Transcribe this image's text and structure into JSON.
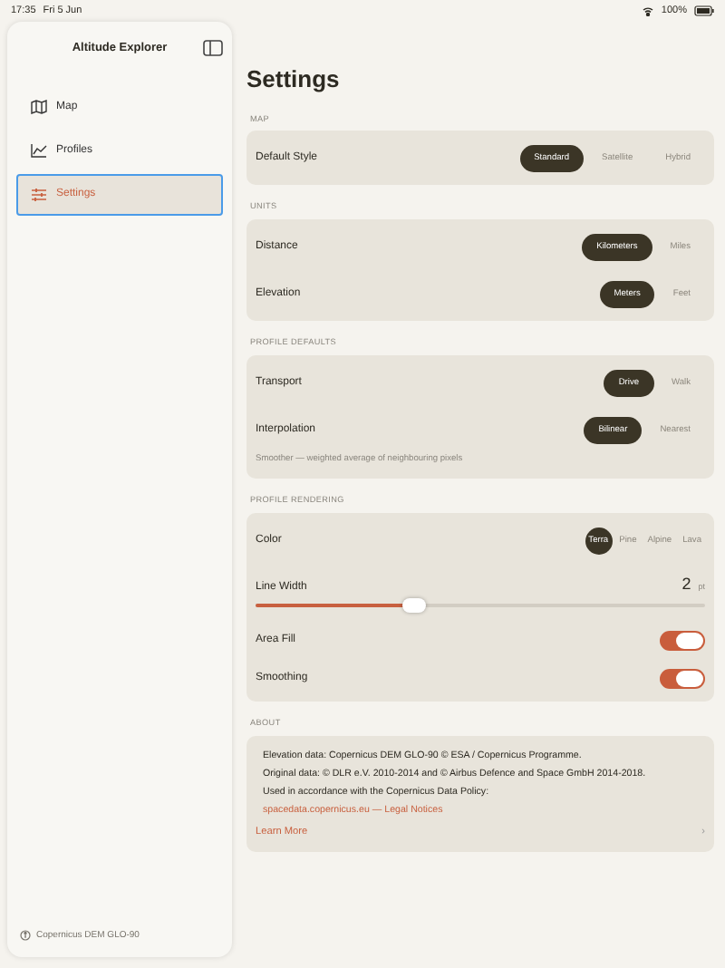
{
  "status_bar": {
    "time": "17:35",
    "date": "Fri 5 Jun",
    "battery": "100%"
  },
  "sidebar": {
    "title": "Altitude Explorer",
    "items": [
      {
        "label": "Map",
        "kind": "map",
        "selected": false
      },
      {
        "label": "Profiles",
        "kind": "chart",
        "selected": false
      },
      {
        "label": "Settings",
        "kind": "sliders",
        "selected": true
      }
    ],
    "footer": "Copernicus DEM GLO-90"
  },
  "title": "Settings",
  "sections": [
    {
      "header": "MAP",
      "rows": [
        {
          "kind": "segmented",
          "label": "Default Style",
          "options": [
            {
              "label": "Standard",
              "selected": true
            },
            {
              "label": "Satellite",
              "selected": false
            },
            {
              "label": "Hybrid",
              "selected": false
            }
          ]
        }
      ]
    },
    {
      "header": "UNITS",
      "rows": [
        {
          "kind": "segmented",
          "label": "Distance",
          "options": [
            {
              "label": "Kilometers",
              "selected": true
            },
            {
              "label": "Miles",
              "selected": false
            }
          ]
        },
        {
          "kind": "segmented",
          "label": "Elevation",
          "options": [
            {
              "label": "Meters",
              "selected": true
            },
            {
              "label": "Feet",
              "selected": false
            }
          ]
        }
      ]
    },
    {
      "header": "PROFILE DEFAULTS",
      "rows": [
        {
          "kind": "segmented",
          "label": "Transport",
          "options": [
            {
              "label": "Drive",
              "selected": true
            },
            {
              "label": "Walk",
              "selected": false
            }
          ]
        },
        {
          "kind": "segmented",
          "label": "Interpolation",
          "options": [
            {
              "label": "Bilinear",
              "selected": true
            },
            {
              "label": "Nearest",
              "selected": false
            }
          ]
        },
        {
          "kind": "note",
          "text": "Smoother — weighted average of neighbouring pixels"
        }
      ]
    },
    {
      "header": "PROFILE RENDERING",
      "rows": [
        {
          "kind": "swatches",
          "label": "Color",
          "options": [
            {
              "label": "Terra",
              "selected": true
            },
            {
              "label": "Pine",
              "selected": false
            },
            {
              "label": "Alpine",
              "selected": false
            },
            {
              "label": "Lava",
              "selected": false
            }
          ]
        },
        {
          "kind": "slider",
          "label": "Line Width",
          "value": "2",
          "unit": "pt",
          "level": 0.35
        },
        {
          "kind": "toggle",
          "label": "Area Fill",
          "on": true
        },
        {
          "kind": "toggle",
          "label": "Smoothing",
          "on": true
        }
      ]
    },
    {
      "header": "ABOUT",
      "rows": [
        {
          "kind": "text",
          "text": "Elevation data: Copernicus DEM GLO-90 © ESA / Copernicus Programme."
        },
        {
          "kind": "text",
          "text": "Original data: © DLR e.V. 2010-2014 and © Airbus Defence and Space GmbH 2014-2018."
        },
        {
          "kind": "text",
          "text": "Used in accordance with the Copernicus Data Policy:"
        },
        {
          "kind": "link",
          "text": "spacedata.copernicus.eu — Legal Notices"
        },
        {
          "kind": "disclosure",
          "text": "Learn More",
          "chevron": "›"
        }
      ]
    }
  ]
}
